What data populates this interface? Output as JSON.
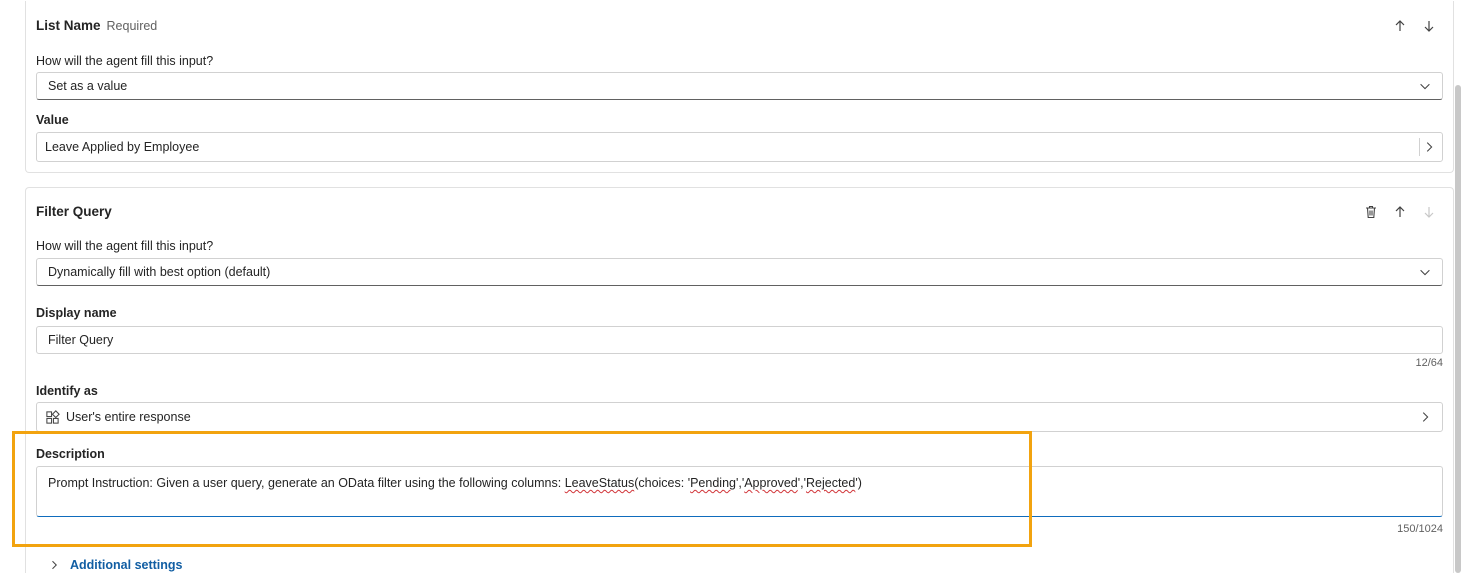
{
  "list_name": {
    "title": "List Name",
    "required": "Required",
    "fill_label": "How will the agent fill this input?",
    "fill_value": "Set as a value",
    "value_label": "Value",
    "value_text": "Leave Applied by Employee"
  },
  "filter_query": {
    "title": "Filter Query",
    "fill_label": "How will the agent fill this input?",
    "fill_value": "Dynamically fill with best option (default)",
    "display_name_label": "Display name",
    "display_name_value": "Filter Query",
    "display_name_counter": "12/64",
    "identify_label": "Identify as",
    "identify_value": "User's entire response",
    "description_label": "Description",
    "description": {
      "prefix": "Prompt Instruction: Given a user query, generate an OData filter using the following columns: ",
      "col": "LeaveStatus",
      "paren": "(choices: '",
      "c1": "Pending",
      "sep1": "','",
      "c2": "Approved",
      "sep2": "','",
      "c3": "Rejected",
      "end": "')"
    },
    "description_counter": "150/1024"
  },
  "additional_settings": "Additional settings",
  "colors": {
    "highlight": "#f2a30f",
    "accent": "#115ea3"
  }
}
